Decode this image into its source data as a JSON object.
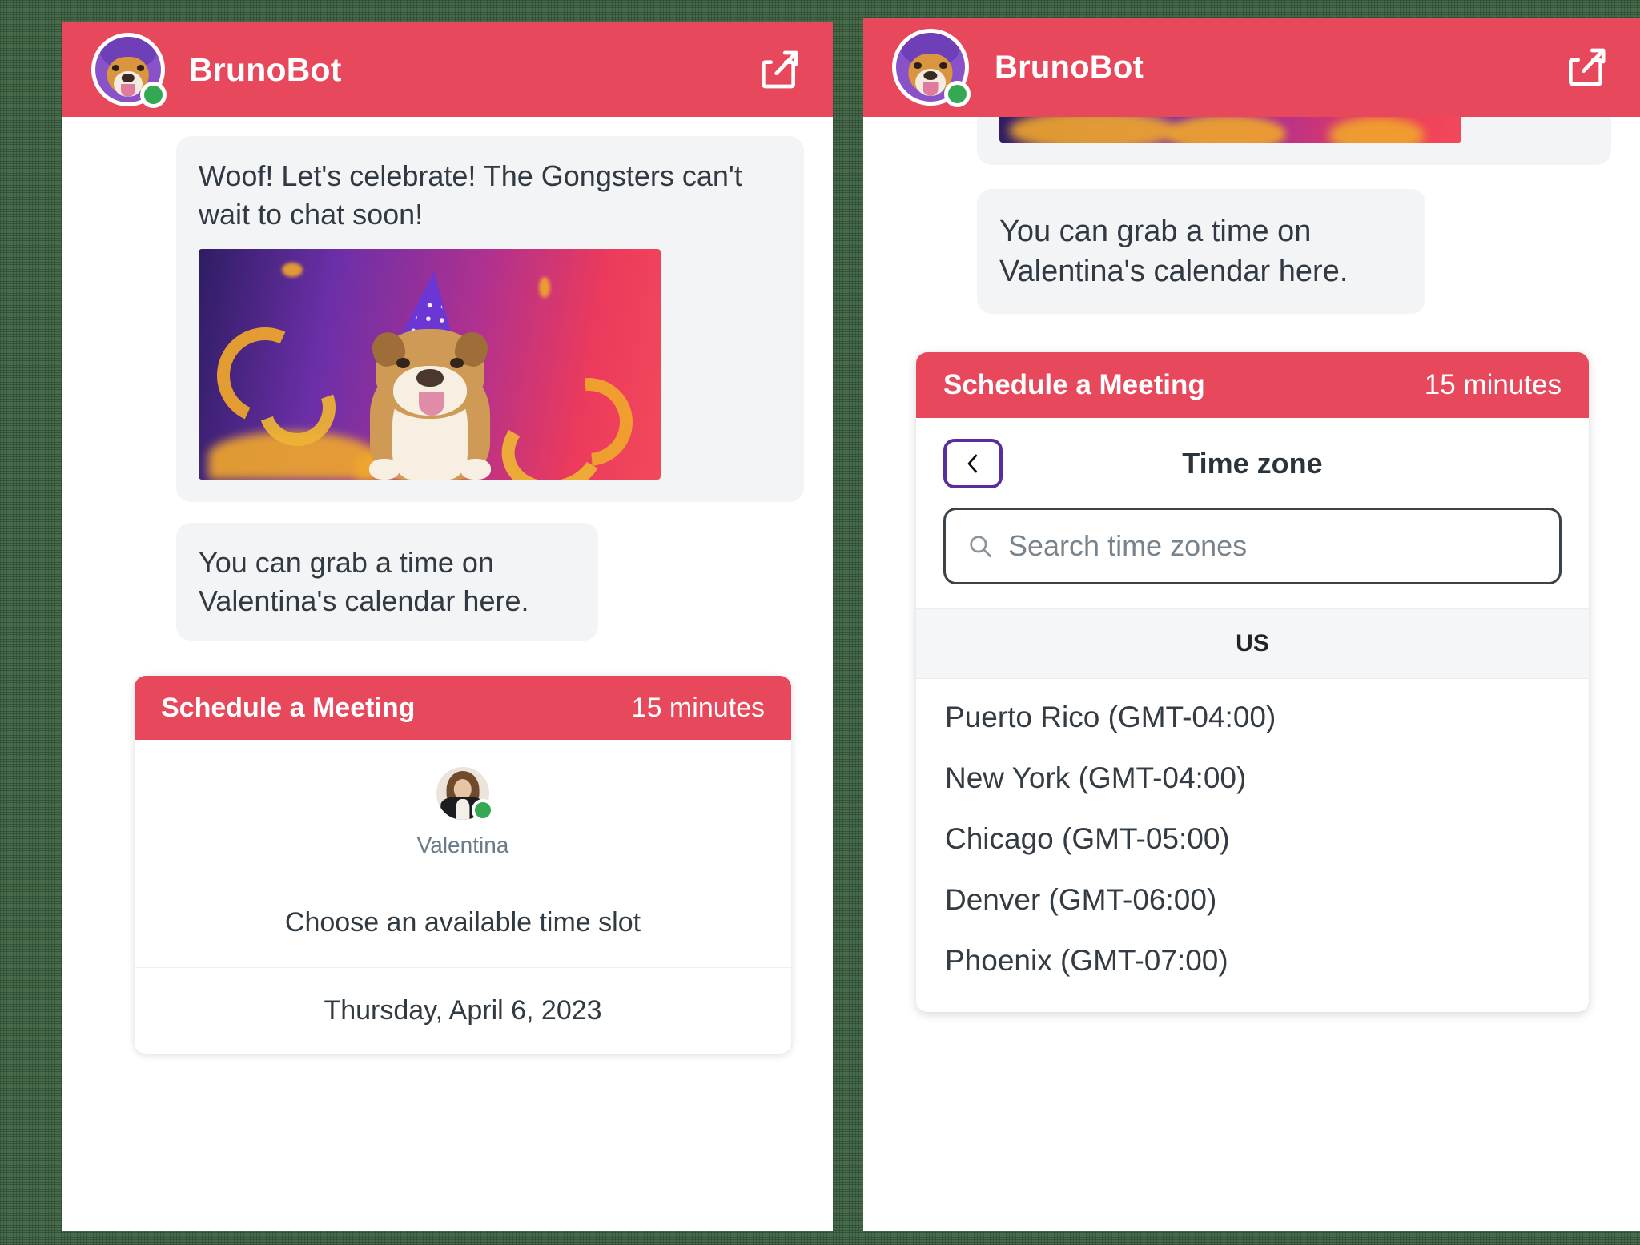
{
  "theme": {
    "brand_red": "#e8485c",
    "bubble_bg": "#f3f4f6",
    "status_green": "#35a853",
    "back_border_purple": "#5a2d9c",
    "page_bg": "#466b4a"
  },
  "left_panel": {
    "header": {
      "bot_name": "BrunoBot",
      "avatar_icon": "bulldog-avatar-icon",
      "status_icon": "online-status-dot",
      "share_icon": "share-icon"
    },
    "messages": [
      {
        "id": "celebrate",
        "text": "Woof! Let's celebrate! The Gongsters can't wait to chat soon!",
        "media_icon": "party-bulldog-gif"
      },
      {
        "id": "calendar-prompt",
        "text": "You can grab a time on Valentina's calendar here."
      }
    ],
    "schedule_card": {
      "title": "Schedule a Meeting",
      "duration": "15 minutes",
      "host_name": "Valentina",
      "host_avatar_icon": "host-avatar-icon",
      "host_status_icon": "online-status-dot",
      "choose_label": "Choose an available time slot",
      "date_label": "Thursday, April 6, 2023"
    }
  },
  "right_panel": {
    "header": {
      "bot_name": "BrunoBot",
      "avatar_icon": "bulldog-avatar-icon",
      "status_icon": "online-status-dot",
      "share_icon": "share-icon"
    },
    "messages": [
      {
        "id": "calendar-prompt",
        "text": "You can grab a time on Valentina's calendar here."
      }
    ],
    "timezone_card": {
      "title": "Schedule a Meeting",
      "duration": "15 minutes",
      "back_icon": "chevron-left-icon",
      "heading": "Time zone",
      "search": {
        "icon": "search-icon",
        "value": "",
        "placeholder": "Search time zones"
      },
      "group_label": "US",
      "items": [
        "Puerto Rico (GMT-04:00)",
        "New York (GMT-04:00)",
        "Chicago (GMT-05:00)",
        "Denver (GMT-06:00)",
        "Phoenix (GMT-07:00)"
      ]
    }
  }
}
